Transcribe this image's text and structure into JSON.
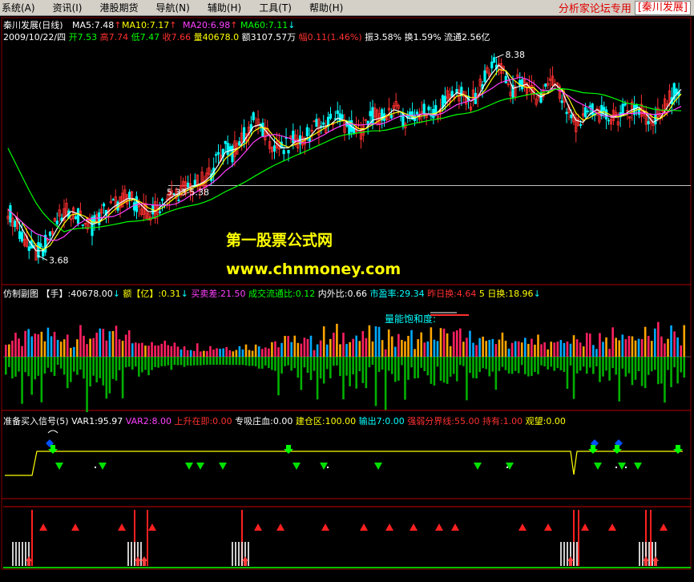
{
  "menubar": {
    "items": [
      "系统(A)",
      "资讯(I)",
      "港股期货",
      "导航(N)",
      "辅助(H)",
      "工具(T)",
      "帮助(H)"
    ],
    "promo": "分析家论坛专用",
    "stock_tag": "[秦川发展]"
  },
  "chart_data": {
    "type": "candlestick",
    "stock_name": "秦川发展(日线)",
    "date": "2009/10/22/四",
    "ohlc_labels": [
      {
        "label": "开",
        "value": "7.53",
        "color": "#00ff00"
      },
      {
        "label": "高",
        "value": "7.74",
        "color": "#ff3030"
      },
      {
        "label": "低",
        "value": "7.47",
        "color": "#00ff00"
      },
      {
        "label": "收",
        "value": "7.66",
        "color": "#ff3030"
      },
      {
        "label": "量",
        "value": "40678.0",
        "color": "#ffff00"
      },
      {
        "label": "额",
        "value": "3107.57万",
        "color": "#ffffff"
      },
      {
        "label": "幅",
        "value": "0.11(1.46%)",
        "color": "#ff3030"
      },
      {
        "label": "振",
        "value": "3.58%",
        "color": "#ffffff"
      },
      {
        "label": "换",
        "value": "1.59%",
        "color": "#ffffff"
      },
      {
        "label": "流通",
        "value": "2.56亿",
        "color": "#ffffff"
      }
    ],
    "ma": [
      {
        "name": "MA5",
        "value": "7.48",
        "color": "#ffffff",
        "arrow": "↑"
      },
      {
        "name": "MA10",
        "value": "7.17",
        "color": "#ffff00",
        "arrow": "↑"
      },
      {
        "name": "MA20",
        "value": "6.98",
        "color": "#ff40ff",
        "arrow": "↑"
      },
      {
        "name": "MA60",
        "value": "7.11",
        "color": "#00ff00",
        "arrow": "↓"
      }
    ],
    "annotations": {
      "high": "8.38",
      "low": "3.68",
      "segment": "5.33-5.38",
      "watermark1": "第一股票公式网",
      "watermark2": "www.chnmoney.com"
    },
    "price_range": [
      3.5,
      8.6
    ],
    "close": [
      4.8,
      4.5,
      4.2,
      3.9,
      3.75,
      3.9,
      4.2,
      4.5,
      4.7,
      4.8,
      4.6,
      4.5,
      4.4,
      4.6,
      4.8,
      4.9,
      5.0,
      5.1,
      5.0,
      4.8,
      4.7,
      4.8,
      5.0,
      5.1,
      5.2,
      5.3,
      5.35,
      5.4,
      5.5,
      5.7,
      6.0,
      6.3,
      6.1,
      6.4,
      6.6,
      6.9,
      6.7,
      6.5,
      6.3,
      6.2,
      6.3,
      6.5,
      6.4,
      6.6,
      6.8,
      6.7,
      6.9,
      7.0,
      6.8,
      6.7,
      6.6,
      6.8,
      7.0,
      6.9,
      7.1,
      7.2,
      7.0,
      6.9,
      7.0,
      7.1,
      7.0,
      7.1,
      7.3,
      7.5,
      7.6,
      7.4,
      7.3,
      7.6,
      7.9,
      8.1,
      8.3,
      7.8,
      7.5,
      7.9,
      7.6,
      7.5,
      7.4,
      7.7,
      7.8,
      7.4,
      7.0,
      6.8,
      6.9,
      7.2,
      7.1,
      7.0,
      6.95,
      7.0,
      7.1,
      7.2,
      7.2,
      6.9,
      6.8,
      7.1,
      7.3,
      7.6,
      7.66
    ],
    "sub1": {
      "title": "仿制副图",
      "fields": [
        {
          "label": "【手】",
          "value": ":40678.00",
          "color": "#ffffff"
        },
        {
          "label": "额【亿】",
          "value": ":0.31",
          "color": "#ffff00"
        },
        {
          "label": "买卖差",
          "value": ":21.50",
          "color": "#ff40ff"
        },
        {
          "label": "成交流通比",
          "value": ":0.12",
          "color": "#00ff00"
        },
        {
          "label": "内外比",
          "value": ":0.66",
          "color": "#ffffff"
        },
        {
          "label": "市盈率",
          "value": ":29.34",
          "color": "#00ffff"
        },
        {
          "label": "昨日换",
          "value": ":4.64",
          "color": "#ff3030"
        },
        {
          "label": "5 日换",
          "value": ":18.96",
          "color": "#ffff00"
        }
      ],
      "label": "量能饱和度:"
    },
    "sub2": {
      "title": "准备买入信号(5)",
      "fields": [
        {
          "label": "VAR1",
          "value": ":95.97",
          "color": "#ffffff"
        },
        {
          "label": "VAR2",
          "value": ":8.00",
          "color": "#ff40ff"
        },
        {
          "label": "上升在即",
          "value": ":0.00",
          "color": "#ff3030"
        },
        {
          "label": "专吸庄血",
          "value": ":0.00",
          "color": "#ffffff"
        },
        {
          "label": "建仓区",
          "value": ":100.00",
          "color": "#ffff00"
        },
        {
          "label": "输出7",
          "value": ":0.00",
          "color": "#00ffff"
        },
        {
          "label": "强弱分界线",
          "value": ":55.00",
          "color": "#ff3030"
        },
        {
          "label": "持有",
          "value": ":1.00",
          "color": "#ff3030"
        },
        {
          "label": "观望",
          "value": ":0.00",
          "color": "#ffff00"
        }
      ]
    }
  }
}
